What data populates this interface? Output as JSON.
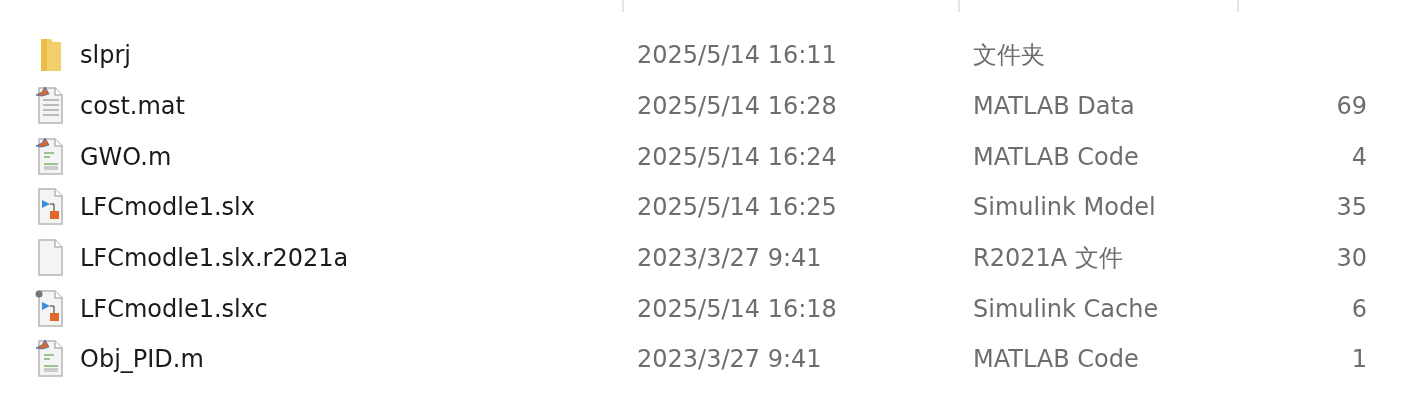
{
  "files": [
    {
      "kind": "folder",
      "name": "slprj",
      "date": "2025/5/14 16:11",
      "type": "文件夹"
    },
    {
      "kind": "matlab-data",
      "name": "cost.mat",
      "date": "2025/5/14 16:28",
      "type": "MATLAB Data",
      "size": "69"
    },
    {
      "kind": "matlab-code",
      "name": "GWO.m",
      "date": "2025/5/14 16:24",
      "type": "MATLAB Code",
      "size": "4"
    },
    {
      "kind": "simulink-model",
      "name": "LFCmodle1.slx",
      "date": "2025/5/14 16:25",
      "type": "Simulink Model",
      "size": "35"
    },
    {
      "kind": "blank",
      "name": "LFCmodle1.slx.r2021a",
      "date": "2023/3/27 9:41",
      "type": "R2021A 文件",
      "size": "30"
    },
    {
      "kind": "simulink-cache",
      "name": "LFCmodle1.slxc",
      "date": "2025/5/14 16:18",
      "type": "Simulink Cache",
      "size": "6"
    },
    {
      "kind": "matlab-code",
      "name": "Obj_PID.m",
      "date": "2023/3/27 9:41",
      "type": "MATLAB Code",
      "size": "1"
    }
  ]
}
